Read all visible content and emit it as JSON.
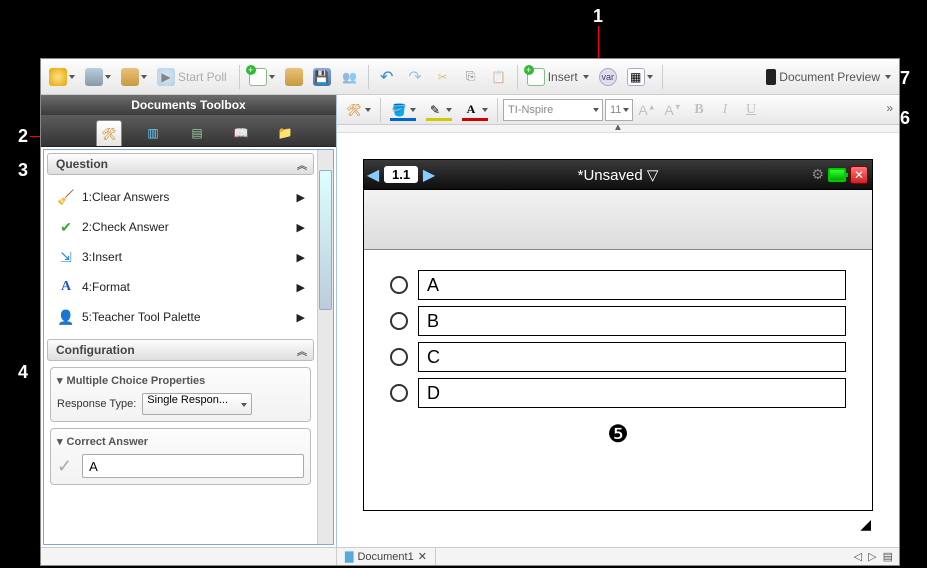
{
  "callouts": {
    "c1": "1",
    "c2": "2",
    "c3": "3",
    "c4": "4",
    "c5": "❺",
    "c6": "6",
    "c7": "7"
  },
  "toolbar": {
    "start_poll": "Start Poll",
    "insert": "Insert",
    "preview": "Document Preview"
  },
  "sidebar": {
    "title": "Documents Toolbox",
    "section_question": "Question",
    "items": [
      {
        "label": "1:Clear Answers"
      },
      {
        "label": "2:Check Answer"
      },
      {
        "label": "3:Insert"
      },
      {
        "label": "4:Format"
      },
      {
        "label": "5:Teacher Tool Palette"
      }
    ],
    "section_config": "Configuration",
    "mcp_title": "Multiple Choice Properties",
    "resp_label": "Response Type:",
    "resp_value": "Single Respon...",
    "correct_title": "Correct Answer",
    "correct_value": "A"
  },
  "format_bar": {
    "font_name": "TI-Nspire",
    "font_size": "11"
  },
  "device": {
    "tab": "1.1",
    "title": "*Unsaved  ▽",
    "options": [
      "A",
      "B",
      "C",
      "D"
    ]
  },
  "doc_tab": {
    "label": "Document1"
  }
}
